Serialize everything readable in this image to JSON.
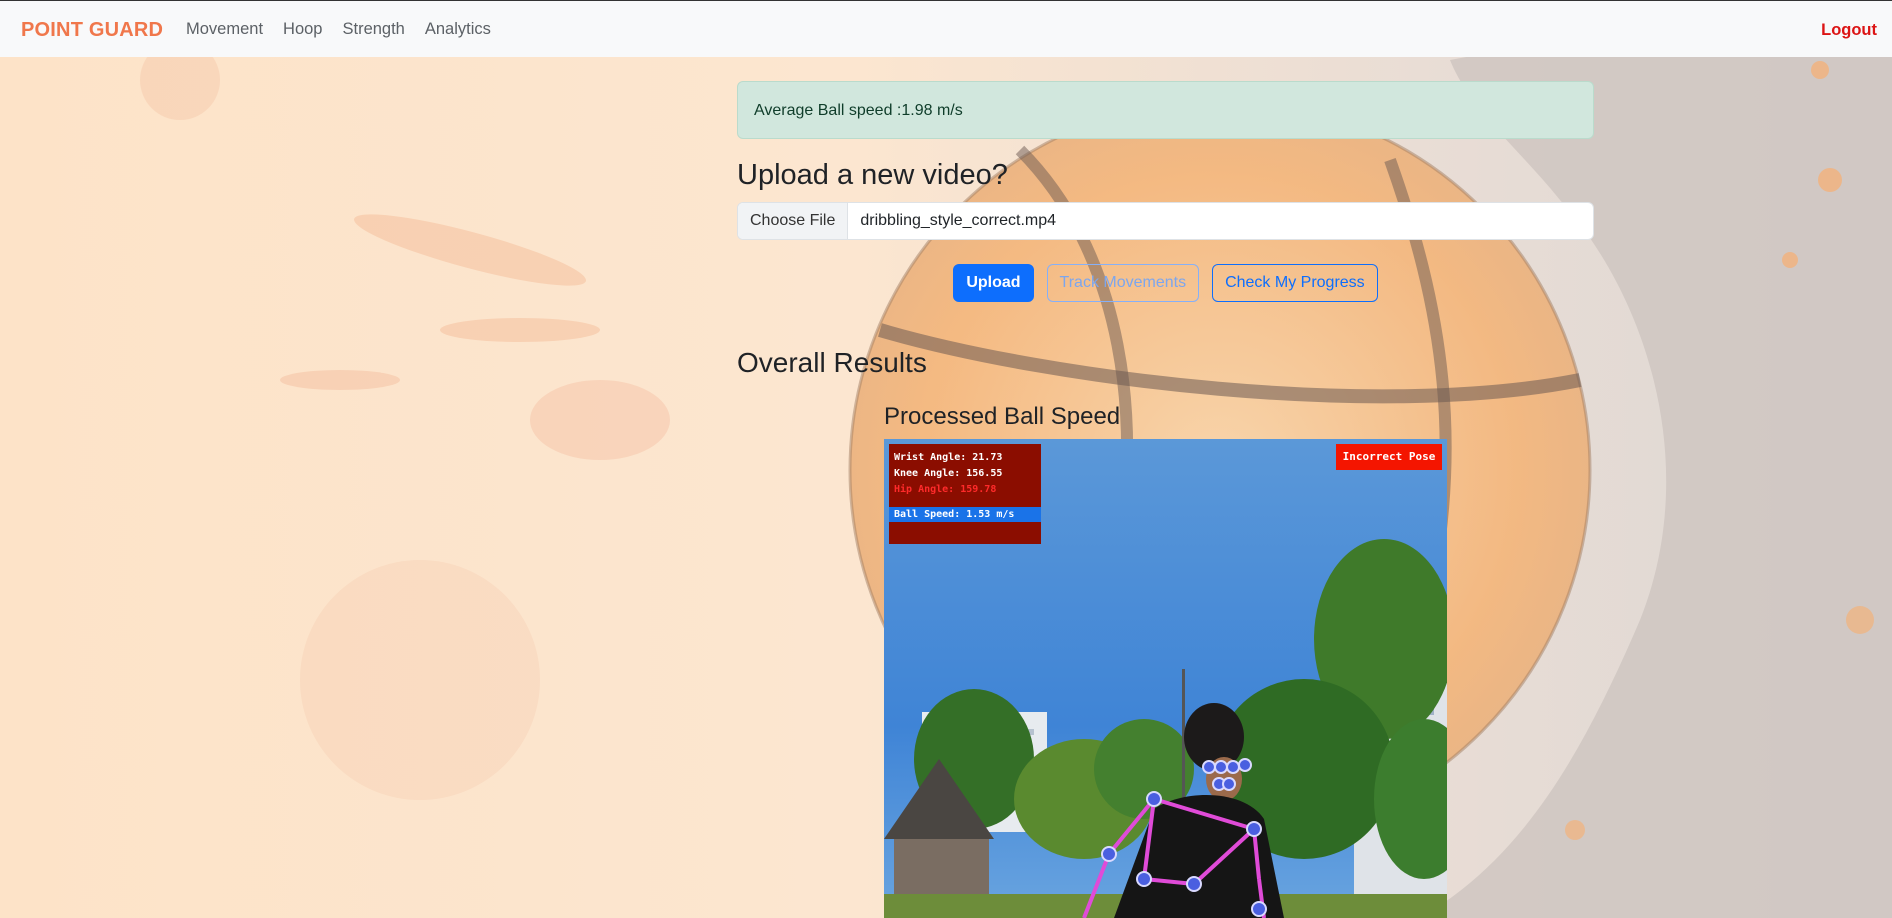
{
  "navbar": {
    "brand": "POINT GUARD",
    "links": [
      "Movement",
      "Hoop",
      "Strength",
      "Analytics"
    ],
    "logout": "Logout"
  },
  "alert": {
    "text": "Average Ball speed :1.98 m/s"
  },
  "upload": {
    "title": "Upload a new video?",
    "choose_file_label": "Choose File",
    "file_name": "dribbling_style_correct.mp4",
    "buttons": {
      "upload": "Upload",
      "track": "Track Movements",
      "progress": "Check My Progress"
    }
  },
  "results": {
    "title": "Overall Results",
    "processed_title": "Processed Ball Speed"
  },
  "video_overlay": {
    "wrist": "Wrist Angle: 21.73",
    "knee": "Knee Angle: 156.55",
    "hip": "Hip Angle: 159.78",
    "ball_speed": "Ball Speed: 1.53 m/s",
    "pose_status": "Incorrect Pose"
  },
  "colors": {
    "brand": "#f0774b",
    "logout": "#dc1414",
    "primary": "#0d6efd",
    "alert_bg": "#d1e7dd",
    "badge": "#f41500"
  }
}
